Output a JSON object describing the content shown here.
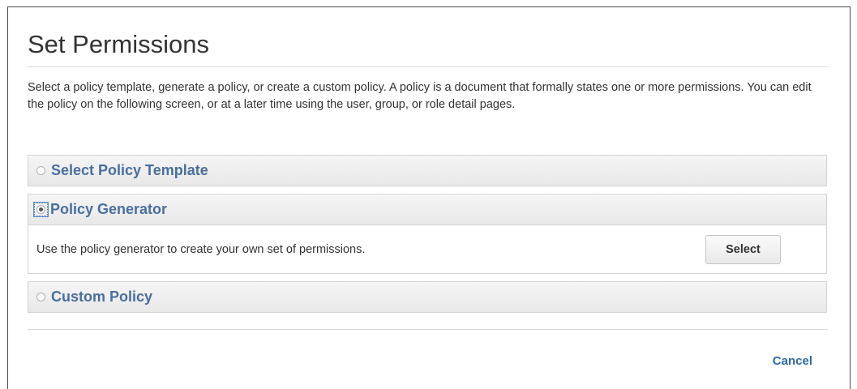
{
  "dialog": {
    "title": "Set Permissions",
    "description": "Select a policy template, generate a policy, or create a custom policy. A policy is a document that formally states one or more permissions. You can edit the policy on the following screen, or at a later time using the user, group, or role detail pages."
  },
  "options": [
    {
      "label": "Select Policy Template",
      "selected": false
    },
    {
      "label": "Policy Generator",
      "selected": true,
      "body_text": "Use the policy generator to create your own set of permissions.",
      "button_label": "Select"
    },
    {
      "label": "Custom Policy",
      "selected": false
    }
  ],
  "footer": {
    "cancel_label": "Cancel"
  },
  "colors": {
    "panel_title": "#4a6f9e",
    "link": "#2c6aa6",
    "text": "#333333"
  }
}
